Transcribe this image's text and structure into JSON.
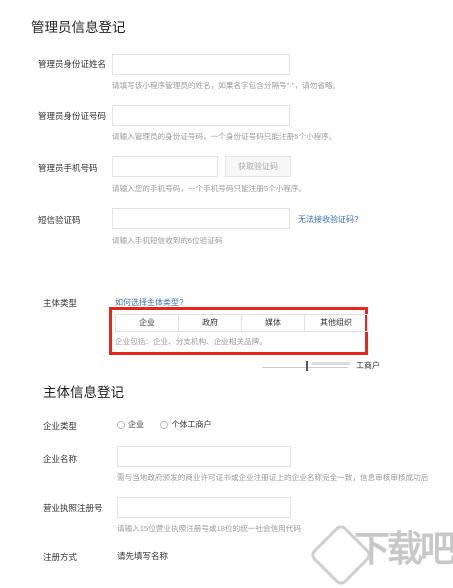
{
  "admin_section": {
    "title": "管理员信息登记",
    "name_field": {
      "label": "管理员身份证姓名",
      "value": "",
      "hint": "请填写该小程序管理员的姓名，如果名字包含分隔号\"·\"，请勿省略。"
    },
    "id_field": {
      "label": "管理员身份证号码",
      "value": "",
      "hint": "请输入管理员的身份证号码，一个身份证号码只能注册5个小程序。"
    },
    "phone_field": {
      "label": "管理员手机号码",
      "value": "",
      "hint": "请输入您的手机号码，一个手机号码只能注册5个小程序。",
      "code_button": "获取验证码"
    },
    "sms_field": {
      "label": "短信验证码",
      "value": "",
      "hint": "请输入手机短信收到的6位验证码",
      "help_link": "无法接收验证码?"
    }
  },
  "subject_type": {
    "label": "主体类型",
    "help_link": "如何选择主体类型?",
    "options": [
      "企业",
      "政府",
      "媒体",
      "其他组织"
    ],
    "desc": "企业包括：企业、分支机构、企业相关品牌。",
    "partial_text": "工商户"
  },
  "subject_section": {
    "title": "主体信息登记",
    "company_type": {
      "label": "企业类型",
      "options": [
        "企业",
        "个体工商户"
      ]
    },
    "company_name": {
      "label": "企业名称",
      "value": "",
      "hint": "需与当地政府颁发的商业许可证书或企业注册证上的企业名称完全一致，信息审核审核成功后"
    },
    "license_no": {
      "label": "营业执照注册号",
      "value": "",
      "hint": "请输入15位营业执照注册号或18位的统一社会信用代码"
    },
    "register_method": {
      "label": "注册方式",
      "value": "请先填写名称"
    }
  },
  "watermark": {
    "text": "下载吧"
  },
  "colors": {
    "highlight_box": "#e5261f",
    "link": "#3a6db5"
  }
}
